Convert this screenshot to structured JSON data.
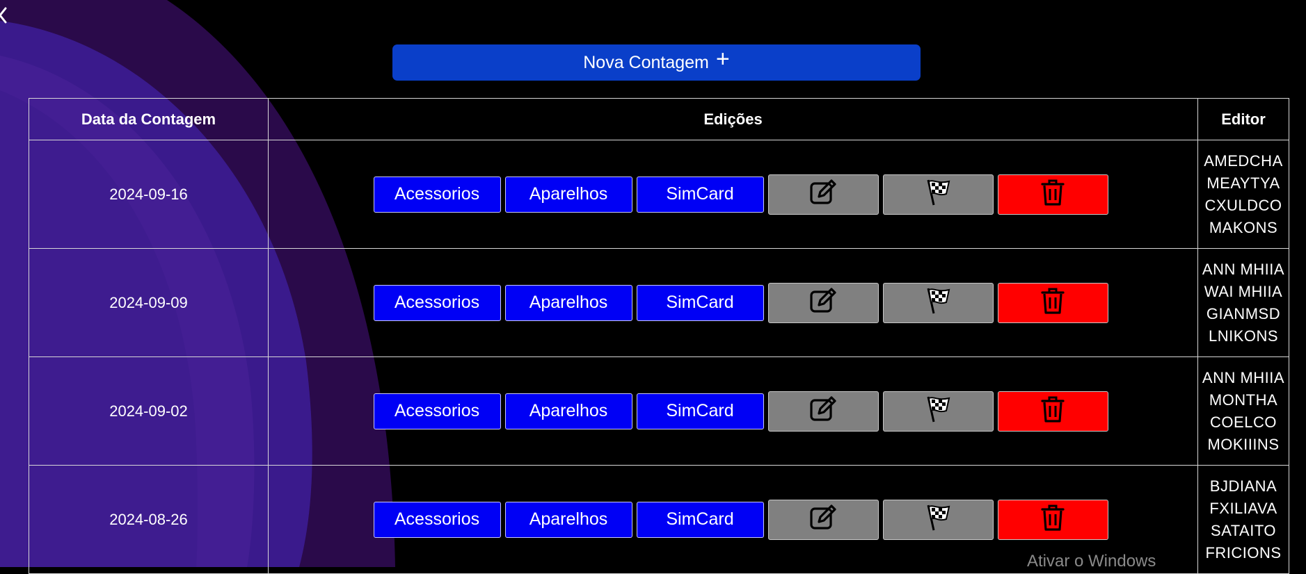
{
  "colors": {
    "background": "#000000",
    "primary_button": "#0a3fc9",
    "edition_button": "#0000f5",
    "action_button": "#808080",
    "delete_button": "#ff0000",
    "wave_purple": "#3a1a8c"
  },
  "new_button": {
    "label": "Nova Contagem",
    "icon": "plus-icon"
  },
  "table": {
    "headers": {
      "date": "Data da Contagem",
      "editions": "Edições",
      "editor": "Editor"
    },
    "edition_labels": {
      "acessorios": "Acessorios",
      "aparelhos": "Aparelhos",
      "simcard": "SimCard"
    },
    "action_icons": {
      "edit": "edit-icon",
      "finish": "checkered-flag-icon",
      "delete": "trash-icon"
    },
    "rows": [
      {
        "date": "2024-09-16",
        "editor": "AMEDCHA\nMEAYTYA\nCXULDCO\nMAKONS"
      },
      {
        "date": "2024-09-09",
        "editor": "ANN MHIIA\nWAI MHIIA\nGIANMSD\nLNIKONS"
      },
      {
        "date": "2024-09-02",
        "editor": "ANN MHIIA\nMONTHA\nCOELCO\nMOKIIINS"
      },
      {
        "date": "2024-08-26",
        "editor": "BJDIANA\nFXILIAVA\nSATAITO\nFRICIONS"
      }
    ]
  },
  "watermark": {
    "text": "Ativar o Windows"
  }
}
